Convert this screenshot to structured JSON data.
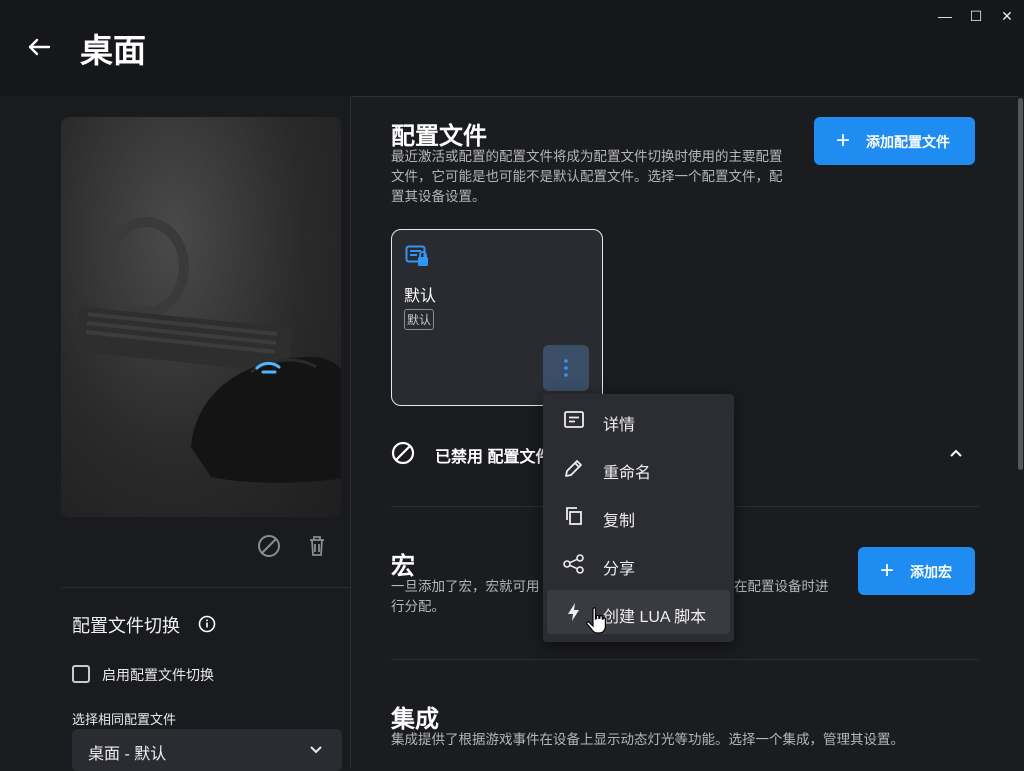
{
  "window": {
    "title": "桌面",
    "back_icon": "arrow-left-icon",
    "controls": {
      "minimize": "—",
      "maximize": "☐",
      "close": "✕"
    }
  },
  "left": {
    "device_image": "gaming-mouse-keyboard-headset-photo",
    "profile_switch": {
      "title": "配置文件切换",
      "enable_label": "启用配置文件切换",
      "enable_checked": false,
      "select_label": "选择相同配置文件",
      "select_value": "桌面 - 默认"
    }
  },
  "profiles": {
    "title": "配置文件",
    "description": "最近激活或配置的配置文件将成为配置文件切换时使用的主要配置文件，它可能是也可能不是默认配置文件。选择一个配置文件，配置其设备设置。",
    "add_button": "添加配置文件",
    "card": {
      "name": "默认",
      "badge": "默认"
    },
    "disabled_label": "已禁用 配置文件"
  },
  "context_menu": {
    "items": [
      {
        "label": "详情",
        "icon": "details-icon"
      },
      {
        "label": "重命名",
        "icon": "pencil-icon"
      },
      {
        "label": "复制",
        "icon": "copy-icon"
      },
      {
        "label": "分享",
        "icon": "share-icon"
      },
      {
        "label": "创建 LUA 脚本",
        "icon": "lightning-icon"
      }
    ],
    "hovered": 4
  },
  "macros": {
    "title": "宏",
    "description_part1": "一旦添加了宏，宏就可用",
    "description_part2": "在配置设备时进",
    "description_line2": "行分配。",
    "add_button": "添加宏"
  },
  "integrations": {
    "title": "集成",
    "description": "集成提供了根据游戏事件在设备上显示动态灯光等功能。选择一个集成，管理其设置。"
  },
  "colors": {
    "accent": "#1e8cf0",
    "background": "#1b1c20",
    "card": "#2a2b30"
  }
}
